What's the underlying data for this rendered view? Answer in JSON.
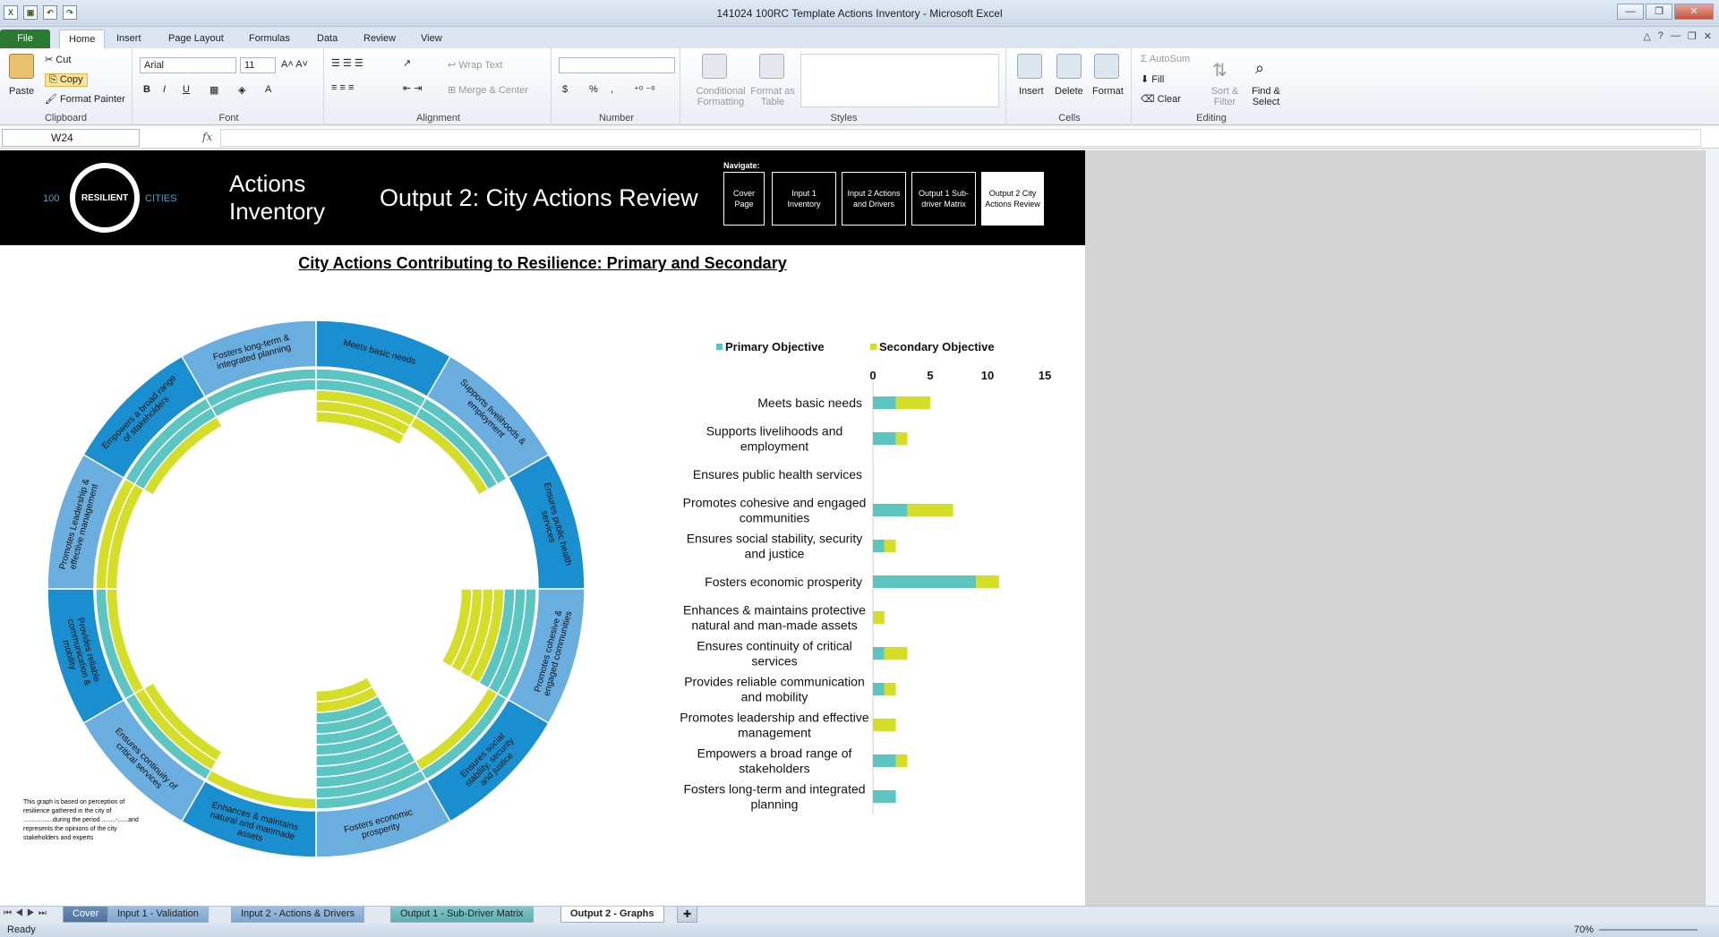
{
  "window": {
    "title": "141024 100RC Template Actions Inventory  -  Microsoft Excel",
    "minimize": "—",
    "restore": "❐",
    "close": "✕"
  },
  "ribbon_tabs": [
    "File",
    "Home",
    "Insert",
    "Page Layout",
    "Formulas",
    "Data",
    "Review",
    "View"
  ],
  "ribbon": {
    "clipboard": {
      "label": "Clipboard",
      "paste": "Paste",
      "cut": "Cut",
      "copy": "Copy",
      "format_painter": "Format Painter"
    },
    "font": {
      "label": "Font",
      "font_name": "Arial",
      "font_size": "11"
    },
    "alignment": {
      "label": "Alignment",
      "wrap_text": "Wrap Text",
      "merge_center": "Merge & Center"
    },
    "number": {
      "label": "Number",
      "currency": "$",
      "percent": "%",
      "comma": ","
    },
    "styles": {
      "label": "Styles",
      "conditional_formatting": "Conditional Formatting",
      "format_as_table": "Format as Table"
    },
    "cells": {
      "label": "Cells",
      "insert": "Insert",
      "delete": "Delete",
      "format": "Format"
    },
    "editing": {
      "label": "Editing",
      "autosum": "AutoSum",
      "fill": "Fill",
      "clear": "Clear",
      "sort_filter": "Sort & Filter",
      "find_select": "Find & Select"
    }
  },
  "formula_bar": {
    "name_box": "W24",
    "fx": "fx",
    "formula": ""
  },
  "banner": {
    "logo_100": "100",
    "logo_resilient": "RESILIENT",
    "logo_cities": "CITIES",
    "title_line1": "Actions",
    "title_line2": "Inventory",
    "subtitle": "Output 2: City Actions Review",
    "navigate_label": "Navigate:",
    "nav": [
      {
        "label": "Cover Page"
      },
      {
        "label": "Input 1 Inventory"
      },
      {
        "label": "Input 2 Actions and Drivers"
      },
      {
        "label": "Output 1 Sub-driver Matrix"
      },
      {
        "label": "Output 2 City Actions Review"
      }
    ]
  },
  "chart_title": "City Actions Contributing to Resilience: Primary and Secondary",
  "footnote": "This graph is based on perception of resilience gathered in the city of .................during the period ........-......and represents the opinions of the city stakeholders and experts",
  "colors": {
    "primary": "#5bc5c1",
    "secondary": "#d4de26",
    "ring_dark": "#1a8fcf",
    "ring_light": "#6aaee0",
    "banner": "#000000"
  },
  "chart_data": [
    {
      "type": "radial-bar",
      "categories": [
        "Meets basic needs",
        "Supports livelihoods & employment",
        "Ensures public health services",
        "Promotes cohesive & engaged communities",
        "Ensures social stability, security and justice",
        "Fosters economic prosperity",
        "Enhances & maintains natural and manmade assets",
        "Ensures continuity of critical services",
        "Provides reliable communication & mobility",
        "Promotes Leadership & effective management",
        "Empowers a broad range of stakeholders",
        "Fosters long-term & integrated planning"
      ],
      "series": [
        {
          "name": "Primary Objective",
          "values": [
            2,
            2,
            0,
            3,
            1,
            9,
            0,
            1,
            1,
            0,
            2,
            2
          ]
        },
        {
          "name": "Secondary Objective",
          "values": [
            3,
            1,
            0,
            4,
            1,
            2,
            1,
            2,
            1,
            2,
            1,
            0
          ]
        }
      ]
    },
    {
      "type": "bar",
      "orientation": "horizontal",
      "stacked": true,
      "categories": [
        "Meets basic needs",
        "Supports livelihoods and employment",
        "Ensures public health services",
        "Promotes cohesive and engaged communities",
        "Ensures social stability, security and justice",
        "Fosters economic prosperity",
        "Enhances & maintains protective natural and man-made assets",
        "Ensures continuity of critical services",
        "Provides reliable communication and mobility",
        "Promotes leadership and effective management",
        "Empowers a broad range of stakeholders",
        "Fosters long-term and integrated planning"
      ],
      "series": [
        {
          "name": "Primary Objective",
          "values": [
            2,
            2,
            0,
            3,
            1,
            9,
            0,
            1,
            1,
            0,
            2,
            2
          ]
        },
        {
          "name": "Secondary Objective",
          "values": [
            3,
            1,
            0,
            4,
            1,
            2,
            1,
            2,
            1,
            2,
            1,
            0
          ]
        }
      ],
      "xlim": [
        0,
        15
      ],
      "xticks": [
        "0",
        "5",
        "10",
        "15"
      ],
      "legend": "top"
    }
  ],
  "sheet_tabs": [
    "Cover",
    "Input 1 - Validation",
    "Input 2 - Actions & Drivers",
    "Output 1 - Sub-Driver Matrix",
    "Output 2 - Graphs"
  ],
  "status": {
    "ready": "Ready",
    "zoom": "70%"
  }
}
